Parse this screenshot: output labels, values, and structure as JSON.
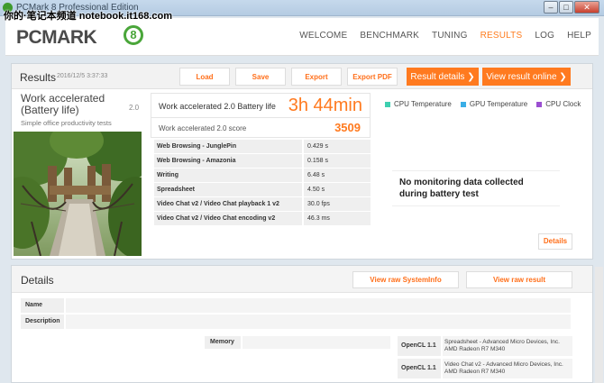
{
  "window": {
    "title": "PCMark 8 Professional Edition",
    "watermark": "你的·笔记本频道 notebook.it168.com",
    "buttons": {
      "min": "–",
      "max": "□",
      "close": "✕"
    }
  },
  "header": {
    "logo": "PCMARK",
    "logo_badge": "8",
    "nav": [
      "WELCOME",
      "BENCHMARK",
      "TUNING",
      "RESULTS",
      "LOG",
      "HELP"
    ],
    "active_nav": "RESULTS"
  },
  "results": {
    "title": "Results",
    "date": "2016/12/5 3:37:33",
    "buttons": {
      "load": "Load",
      "save": "Save",
      "export": "Export",
      "export_pdf": "Export PDF",
      "result_details": "Result details ❯",
      "view_online": "View result online ❯"
    },
    "test": {
      "name_line1": "Work accelerated",
      "name_line2": "(Battery life)",
      "version": "2.0",
      "subtitle": "Simple office productivity tests"
    },
    "battery": {
      "label": "Work accelerated 2.0 Battery life",
      "value": "3h 44min"
    },
    "score": {
      "label": "Work accelerated 2.0 score",
      "value": "3509"
    },
    "metrics": [
      {
        "name": "Web Browsing - JunglePin",
        "value": "0.429 s"
      },
      {
        "name": "Web Browsing - Amazonia",
        "value": "0.158 s"
      },
      {
        "name": "Writing",
        "value": "6.48 s"
      },
      {
        "name": "Spreadsheet",
        "value": "4.50 s"
      },
      {
        "name": "Video Chat v2 / Video Chat playback 1 v2",
        "value": "30.0 fps"
      },
      {
        "name": "Video Chat v2 / Video Chat encoding v2",
        "value": "46.3 ms"
      }
    ],
    "monitoring": {
      "legend": [
        {
          "label": "CPU Temperature",
          "color": "#3fcfb0"
        },
        {
          "label": "GPU Temperature",
          "color": "#3aaee6"
        },
        {
          "label": "CPU Clock",
          "color": "#9b4fd1"
        }
      ],
      "no_data": "No monitoring data collected during battery test",
      "details_button": "Details"
    }
  },
  "details": {
    "title": "Details",
    "buttons": {
      "view_raw_sysinfo": "View raw SystemInfo",
      "view_raw_result": "View raw result"
    },
    "fields": {
      "name_label": "Name",
      "description_label": "Description",
      "memory_label": "Memory"
    },
    "opencl": [
      {
        "label": "OpenCL 1.1",
        "value": "Spreadsheet - Advanced Micro Devices, Inc. AMD Radeon R7 M340"
      },
      {
        "label": "OpenCL 1.1",
        "value": "Video Chat v2 - Advanced Micro Devices, Inc. AMD Radeon R7 M340"
      }
    ]
  }
}
